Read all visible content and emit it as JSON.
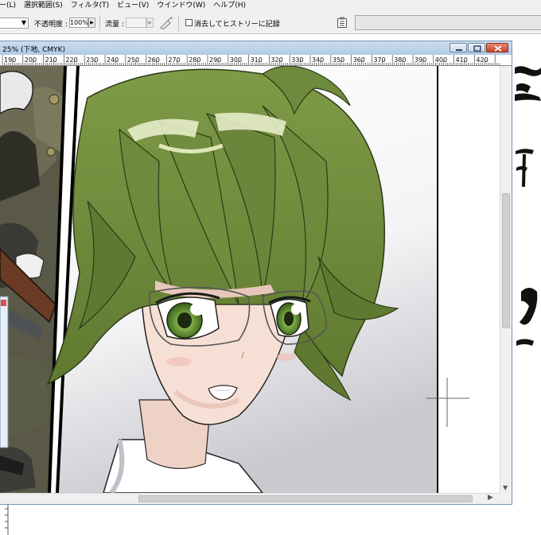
{
  "menubar": {
    "items": [
      {
        "label": "ー(L)"
      },
      {
        "label": "選択範囲(S)"
      },
      {
        "label": "フィルタ(T)"
      },
      {
        "label": "ビュー(V)"
      },
      {
        "label": "ウインドウ(W)"
      },
      {
        "label": "ヘルプ(H)"
      }
    ]
  },
  "toolbar": {
    "opacity_label": "不透明度 :",
    "opacity_value": "100%",
    "flow_label": "流量 :",
    "flow_value": "",
    "erase_history_label": "消去してヒストリーに記録",
    "erase_history_checked": false
  },
  "document": {
    "title": "25% (下地, CMYK)",
    "zoom": "25%",
    "layer": "下地",
    "color_mode": "CMYK",
    "ruler_ticks": [
      "190",
      "200",
      "210",
      "220",
      "230",
      "240",
      "250",
      "260",
      "270",
      "280",
      "290",
      "300",
      "310",
      "320",
      "330",
      "340",
      "350",
      "360",
      "370",
      "380",
      "390",
      "400",
      "410",
      "420"
    ]
  },
  "colors": {
    "hair_green": "#6e8a3c",
    "hair_shadow": "#4a5f27",
    "skin": "#f6e0d6",
    "eye_green": "#4f7a2c",
    "window_title_bg": "#bcd3ea",
    "close_button": "#c6452c"
  },
  "icons": {
    "airbrush": "airbrush-icon",
    "panel": "panel-icon",
    "minimize": "minimize-icon",
    "maximize": "maximize-icon",
    "close": "close-icon"
  }
}
